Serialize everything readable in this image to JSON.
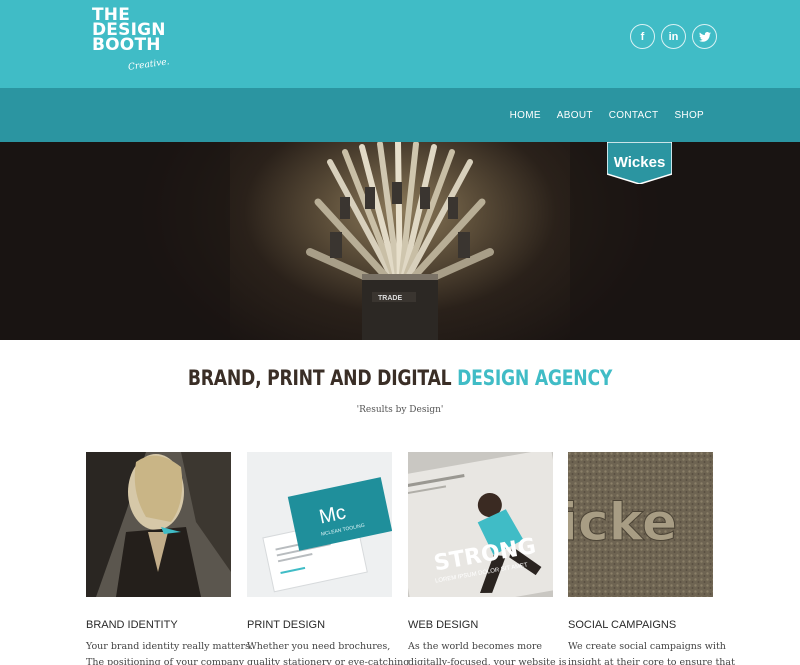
{
  "header": {
    "logo": {
      "line1": "THE",
      "line2": "DESIGN",
      "line3": "BOOTH",
      "script": "Creative."
    },
    "social": [
      {
        "icon": "facebook-icon",
        "glyph": "f"
      },
      {
        "icon": "linkedin-icon",
        "glyph": "in"
      },
      {
        "icon": "twitter-icon",
        "glyph": "t"
      }
    ]
  },
  "nav": {
    "items": [
      "HOME",
      "ABOUT",
      "CONTACT",
      "SHOP"
    ]
  },
  "hero": {
    "badge": "Wickes",
    "can_label": "TRADE"
  },
  "intro": {
    "headline_main": "BRAND, PRINT AND DIGITAL ",
    "headline_accent": "DESIGN AGENCY",
    "tagline": "'Results by Design'"
  },
  "services": [
    {
      "title": "BRAND IDENTITY",
      "text": "Your brand identity really matters. The positioning of your company"
    },
    {
      "title": "PRINT DESIGN",
      "text": "Whether you need brochures, quality stationery or eye-catching",
      "card_logo": "Mc",
      "card_sub": "MCLEAN TOOLING"
    },
    {
      "title": "WEB DESIGN",
      "text": "As the world becomes more digitally-focused, your website is",
      "poster_word": "STRONG",
      "poster_sub": "LOREM IPSUM DOLOR SIT AMET"
    },
    {
      "title": "SOCIAL CAMPAIGNS",
      "text": "We create social campaigns with insight at their core to ensure that",
      "texture_word": "icke"
    }
  ],
  "colors": {
    "teal": "#40bcc6",
    "teal_dark": "#2b95a1",
    "heading": "#3a2e26"
  }
}
